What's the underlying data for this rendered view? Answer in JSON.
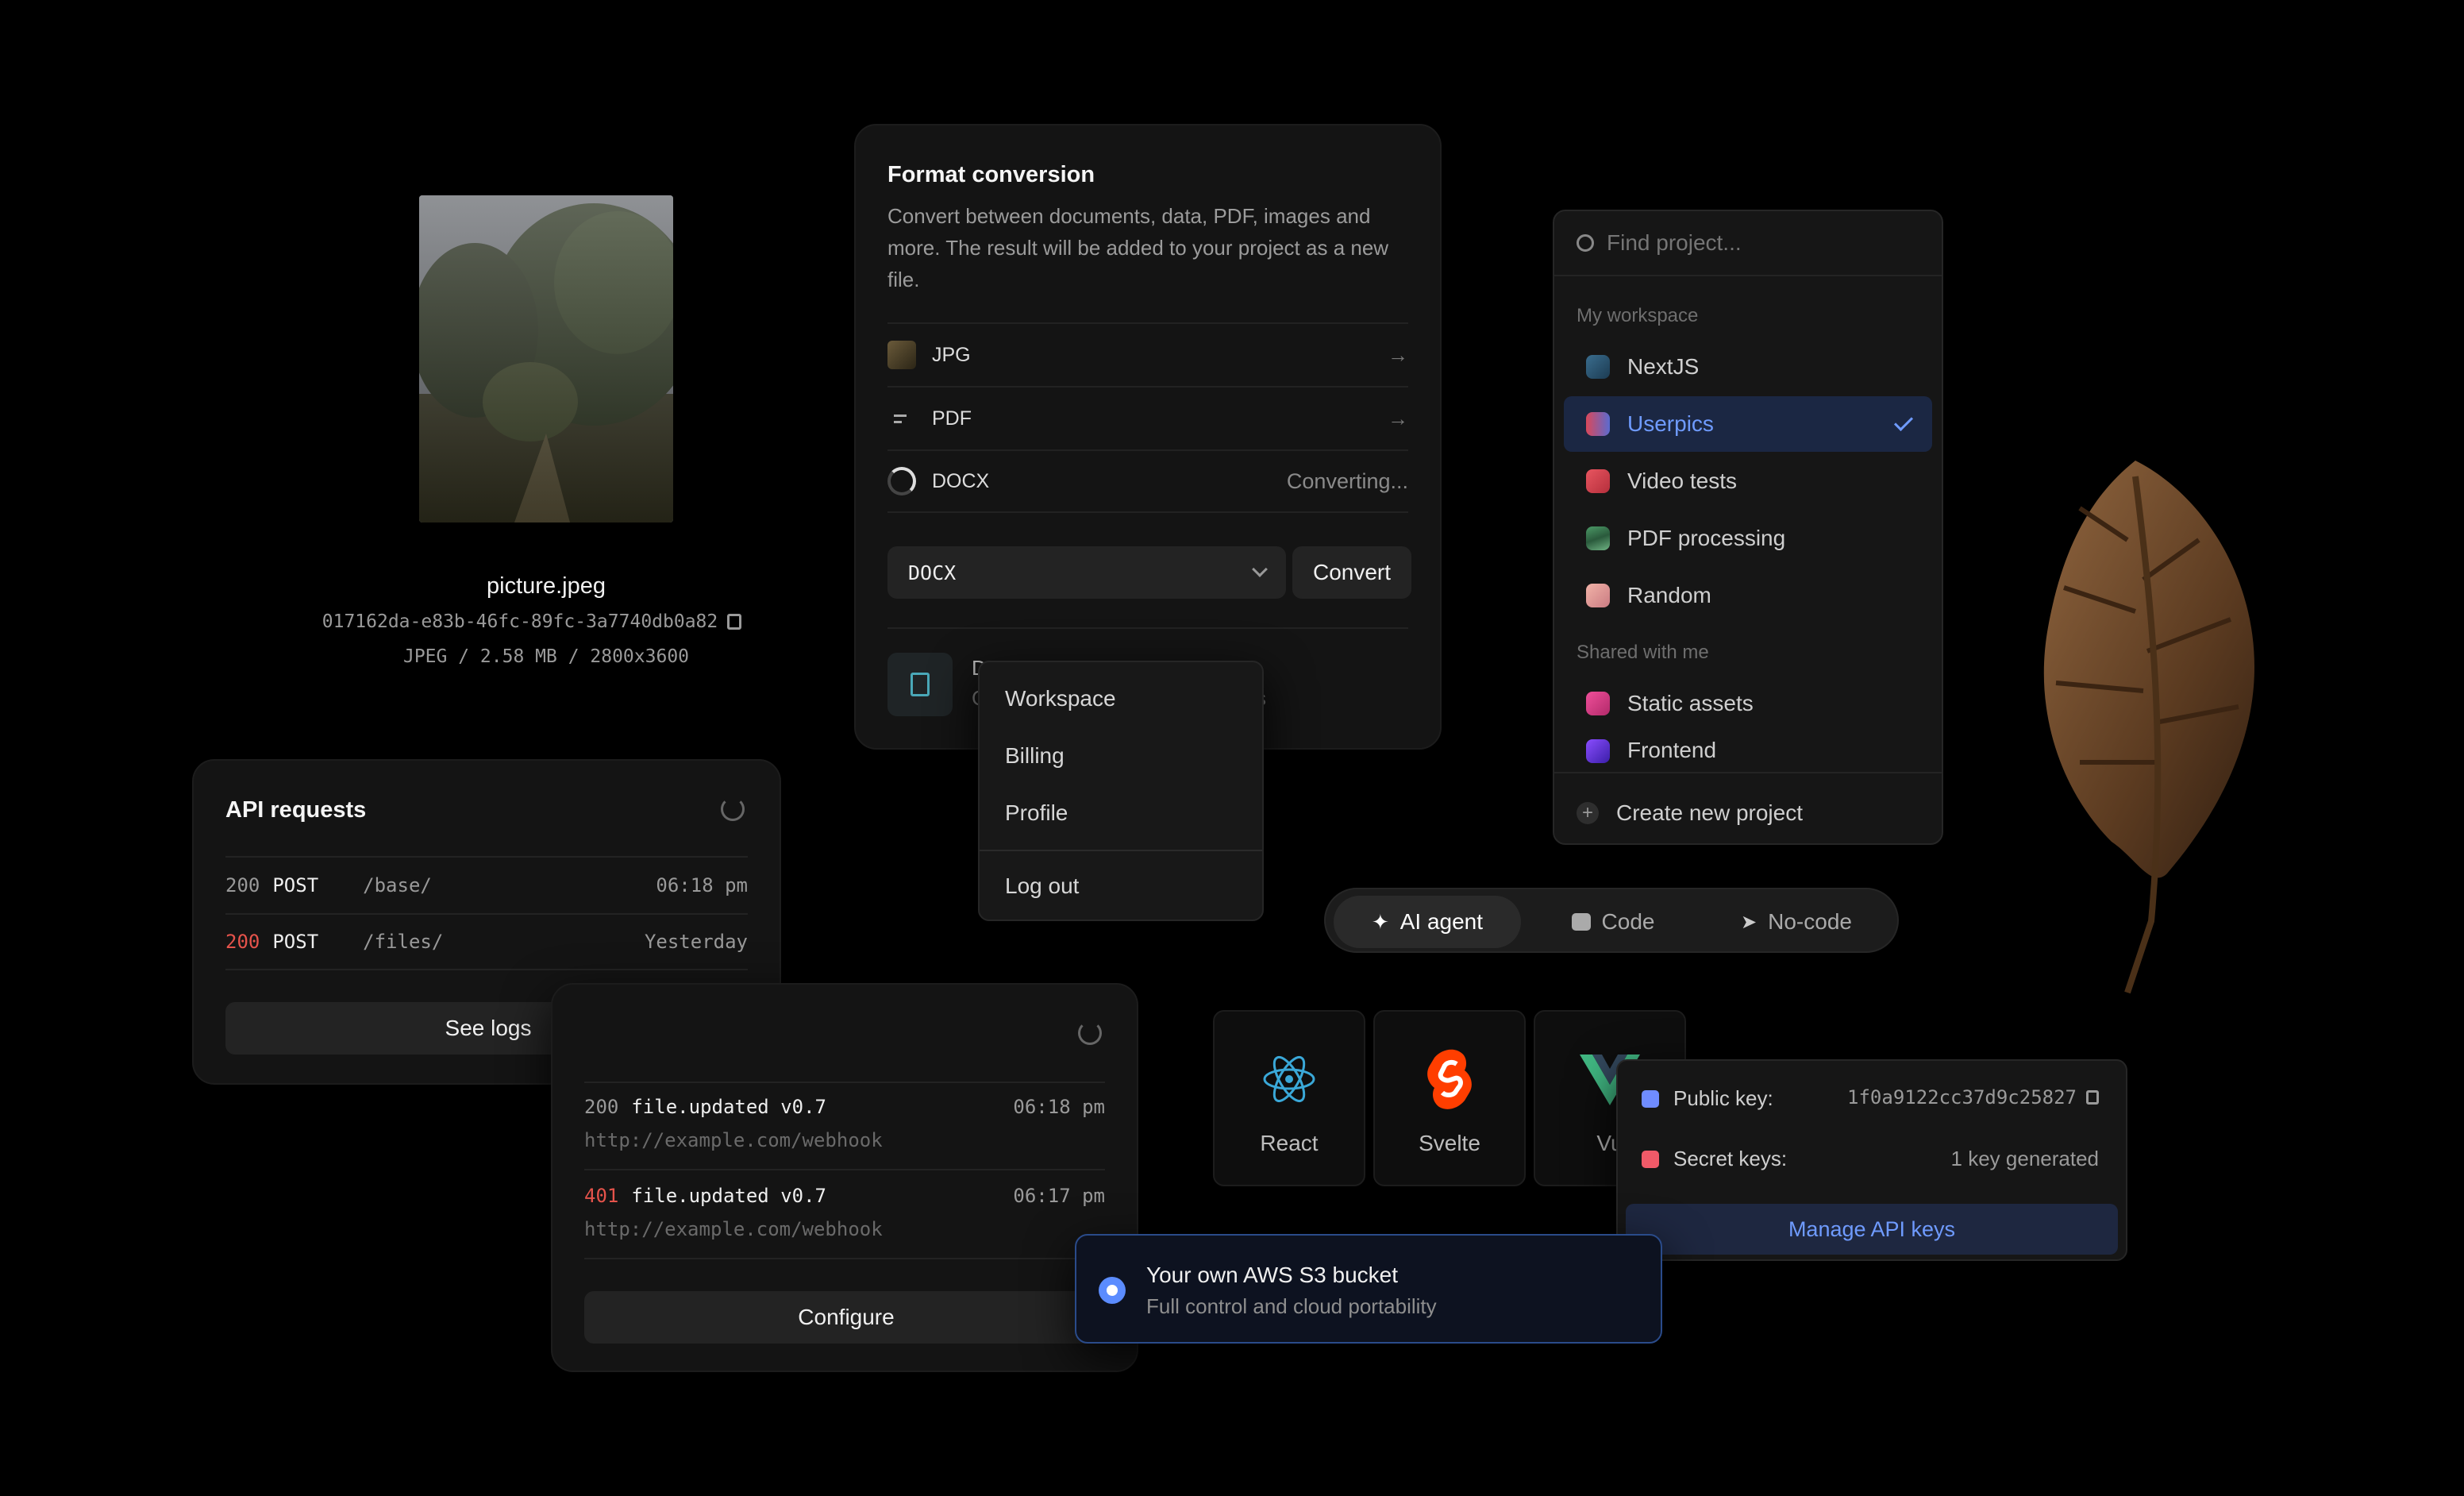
{
  "file": {
    "name": "picture.jpeg",
    "hash": "017162da-e83b-46fc-89fc-3a7740db0a82",
    "meta": "JPEG / 2.58 MB / 2800x3600"
  },
  "format_conversion": {
    "title": "Format conversion",
    "description": "Convert between documents, data, PDF, images and more. The result will be added to your project as a new file.",
    "rows": [
      {
        "label": "JPG",
        "status": "→"
      },
      {
        "label": "PDF",
        "status": "→"
      },
      {
        "label": "DOCX",
        "status": "Converting..."
      }
    ],
    "select_value": "DOCX",
    "convert_label": "Convert",
    "partial_line1": "D",
    "partial_line2": "C",
    "partial_tail": "s"
  },
  "account_menu": {
    "items": [
      "Workspace",
      "Billing",
      "Profile"
    ],
    "logout": "Log out"
  },
  "projects": {
    "search_placeholder": "Find project...",
    "my_workspace_label": "My workspace",
    "shared_label": "Shared with me",
    "my_workspace": [
      {
        "name": "NextJS",
        "color": "#2b5a7a"
      },
      {
        "name": "Userpics",
        "color": "#c24b5a"
      },
      {
        "name": "Video tests",
        "color": "#d9454f"
      },
      {
        "name": "PDF processing",
        "color": "#3f8a5a"
      },
      {
        "name": "Random",
        "color": "#e7a19a"
      }
    ],
    "shared": [
      {
        "name": "Static assets",
        "color": "#e0438a"
      },
      {
        "name": "Frontend",
        "color": "#6a3ad8"
      }
    ],
    "selected": "Userpics",
    "create_label": "Create new project"
  },
  "api_requests": {
    "title": "API requests",
    "rows": [
      {
        "status": "200",
        "method": "POST",
        "path": "/base/",
        "time": "06:18 pm"
      },
      {
        "status": "200",
        "method": "POST",
        "path": "/files/",
        "time": "Yesterday"
      }
    ],
    "see_logs": "See logs"
  },
  "webhooks": {
    "rows": [
      {
        "status": "200",
        "event": "file.updated v0.7",
        "url": "http://example.com/webhook",
        "time": "06:18 pm"
      },
      {
        "status": "401",
        "event": "file.updated v0.7",
        "url": "http://example.com/webhook",
        "time": "06:17 pm"
      }
    ],
    "configure": "Configure"
  },
  "mode_tabs": {
    "items": [
      "AI agent",
      "Code",
      "No-code"
    ],
    "active": "AI agent"
  },
  "frameworks": {
    "items": [
      "React",
      "Svelte",
      "Vu"
    ]
  },
  "storage": {
    "title": "Your own AWS S3 bucket",
    "subtitle": "Full control and cloud portability"
  },
  "api_keys": {
    "public_label": "Public key:",
    "public_value": "1f0a9122cc37d9c25827",
    "secret_label": "Secret keys:",
    "secret_value": "1 key generated",
    "manage": "Manage API keys"
  },
  "colors": {
    "accent": "#5b8cff",
    "error": "#e5534b",
    "background": "#000000",
    "card": "#141414"
  }
}
